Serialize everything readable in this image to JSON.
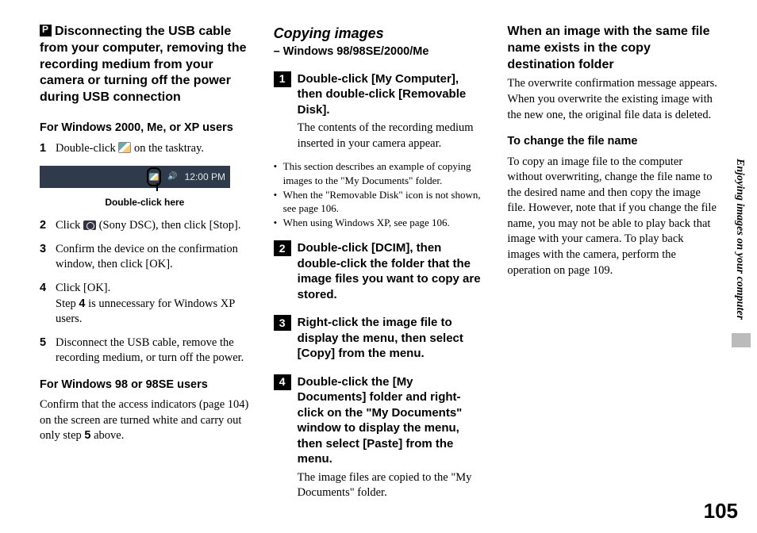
{
  "side_label": "Enjoying images on your computer",
  "page_number": "105",
  "col1": {
    "heading": "Disconnecting the USB cable from your computer, removing the recording medium from your camera or turning off the power during USB connection",
    "sub1": "For Windows 2000, Me, or XP users",
    "steps": [
      {
        "n": "1",
        "pre": "Double-click ",
        "post": " on the tasktray."
      },
      {
        "n": "2",
        "pre": "Click ",
        "mid": " (Sony DSC), then click [Stop]."
      },
      {
        "n": "3",
        "text": "Confirm the device on the confirmation window, then click [OK]."
      },
      {
        "n": "4",
        "text_a": "Click [OK].",
        "text_b_pre": "Step ",
        "text_b_bold": "4",
        "text_b_post": " is unnecessary for Windows XP users."
      },
      {
        "n": "5",
        "text": "Disconnect the USB cable, remove the recording medium, or turn off the power."
      }
    ],
    "tray_time": "12:00 PM",
    "dbl_here": "Double-click here",
    "sub2": "For Windows 98 or 98SE users",
    "para2_a": "Confirm that the access indicators (page 104) on the screen are turned white and carry out only step ",
    "para2_bold": "5",
    "para2_b": " above."
  },
  "col2": {
    "title": "Copying images",
    "subtitle": "– Windows 98/98SE/2000/Me",
    "steps": [
      {
        "n": "1",
        "bold": "Double-click [My Computer], then double-click [Removable Disk].",
        "rom": "The contents of the recording medium inserted in your camera appear."
      },
      {
        "n": "2",
        "bold": "Double-click [DCIM], then double-click the folder that the image files you want to copy are stored."
      },
      {
        "n": "3",
        "bold": "Right-click the image file to display the menu, then select [Copy] from the menu."
      },
      {
        "n": "4",
        "bold": "Double-click the [My Documents] folder and right-click on the \"My Documents\" window to display the menu, then select [Paste] from the menu.",
        "rom": "The image files are copied to the \"My Documents\" folder."
      }
    ],
    "bullets": [
      "This section describes an example of copying images to the \"My Documents\" folder.",
      "When the \"Removable Disk\" icon is not shown, see page 106.",
      "When using Windows XP, see page 106."
    ]
  },
  "col3": {
    "h1": "When an image with the same file name exists in the copy destination folder",
    "p1": "The overwrite confirmation message appears. When you overwrite the existing image with the new one, the original file data is deleted.",
    "h2": "To change the file name",
    "p2": "To copy an image file to the computer without overwriting, change the file name to the desired name and then copy the image file. However, note that if you change the file name, you may not be able to play back that image with your camera. To play back images with the camera, perform the operation on page 109."
  }
}
